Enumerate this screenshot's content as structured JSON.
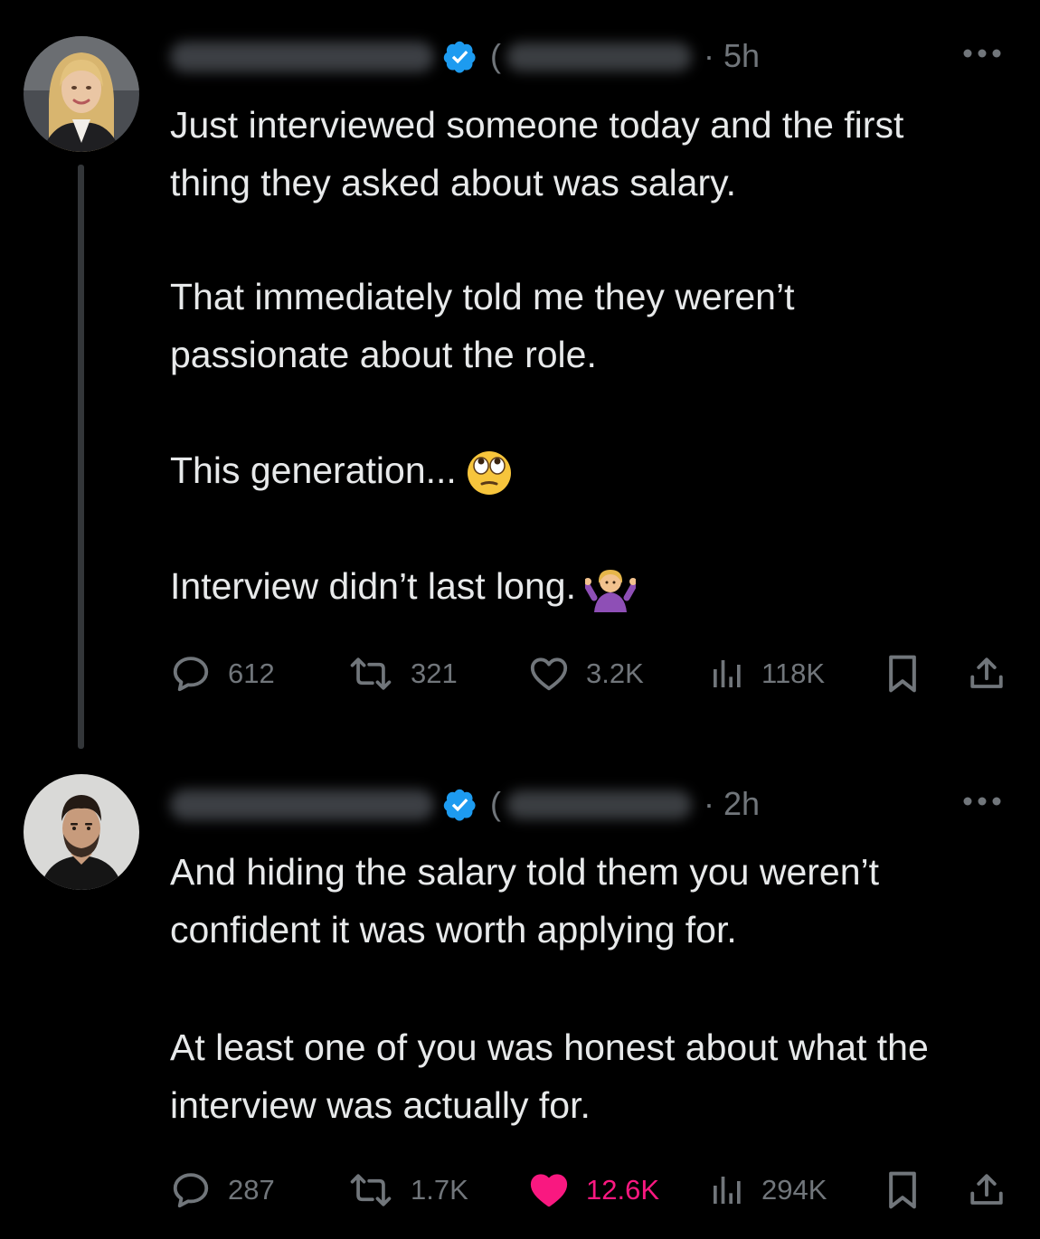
{
  "tweet1": {
    "timestamp": "· 5h",
    "paragraphs": [
      "Just interviewed someone today and the first thing they asked about was salary.",
      "That immediately told me they weren’t passionate about the role.",
      "This generation...",
      "Interview didn’t last long."
    ],
    "emojis": [
      "face-with-rolling-eyes-icon",
      "person-shrugging-icon"
    ],
    "replies": "612",
    "reposts": "321",
    "likes": "3.2K",
    "views": "118K",
    "liked": false
  },
  "tweet2": {
    "timestamp": "· 2h",
    "paragraphs": [
      "And hiding the salary told them you weren’t confident it was worth applying for.",
      "At least one of you was honest about what the interview was actually for."
    ],
    "replies": "287",
    "reposts": "1.7K",
    "likes": "12.6K",
    "views": "294K",
    "liked": true
  },
  "colors": {
    "background": "#000000",
    "text": "#e7e9ea",
    "muted": "#71767b",
    "verified": "#1d9bf0",
    "like_active": "#f91880",
    "thread_line": "#333639"
  }
}
